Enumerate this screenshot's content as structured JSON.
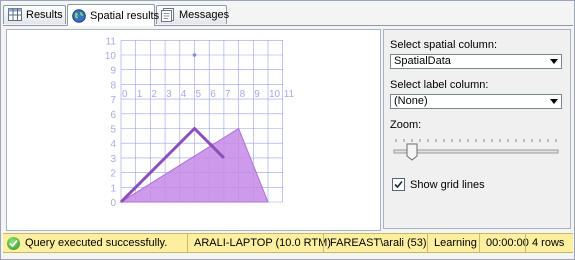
{
  "tabs": [
    {
      "label": "Results",
      "icon": "grid-icon",
      "active": false
    },
    {
      "label": "Spatial results",
      "icon": "globe-icon",
      "active": true
    },
    {
      "label": "Messages",
      "icon": "messages-icon",
      "active": false
    }
  ],
  "map": {
    "y_ticks": [
      "0",
      "1",
      "2",
      "3",
      "4",
      "5",
      "6",
      "7",
      "8",
      "9",
      "10",
      "11"
    ],
    "x_ticks": [
      "0",
      "1",
      "2",
      "3",
      "4",
      "5",
      "6",
      "7",
      "8",
      "9",
      "10",
      "11"
    ],
    "polygon": [
      [
        0,
        0
      ],
      [
        8,
        5
      ],
      [
        10,
        0
      ]
    ],
    "linestring": [
      [
        0,
        0
      ],
      [
        5,
        5
      ],
      [
        7,
        3
      ]
    ],
    "point": [
      5,
      10
    ],
    "colors": {
      "grid": "#9aa0f0",
      "axis_label": "#a8aae8",
      "polygon_fill": "#c48ae6",
      "polygon_stroke": "#b070d8",
      "line": "#8a4fb8",
      "point": "#8a8adc"
    }
  },
  "options": {
    "spatial_column_label": "Select spatial column:",
    "spatial_column_value": "SpatialData",
    "label_column_label": "Select label column:",
    "label_column_value": "(None)",
    "zoom_label": "Zoom:",
    "zoom_level": 0.1,
    "grid_lines_label": "Show grid lines",
    "grid_lines_checked": true
  },
  "status": {
    "message": "Query executed successfully.",
    "server": "ARALI-LAPTOP (10.0 RTM)",
    "user": "FAREAST\\arali (53)",
    "database": "Learning",
    "elapsed": "00:00:00",
    "rows": "4 rows",
    "color": "#fdefa0"
  }
}
